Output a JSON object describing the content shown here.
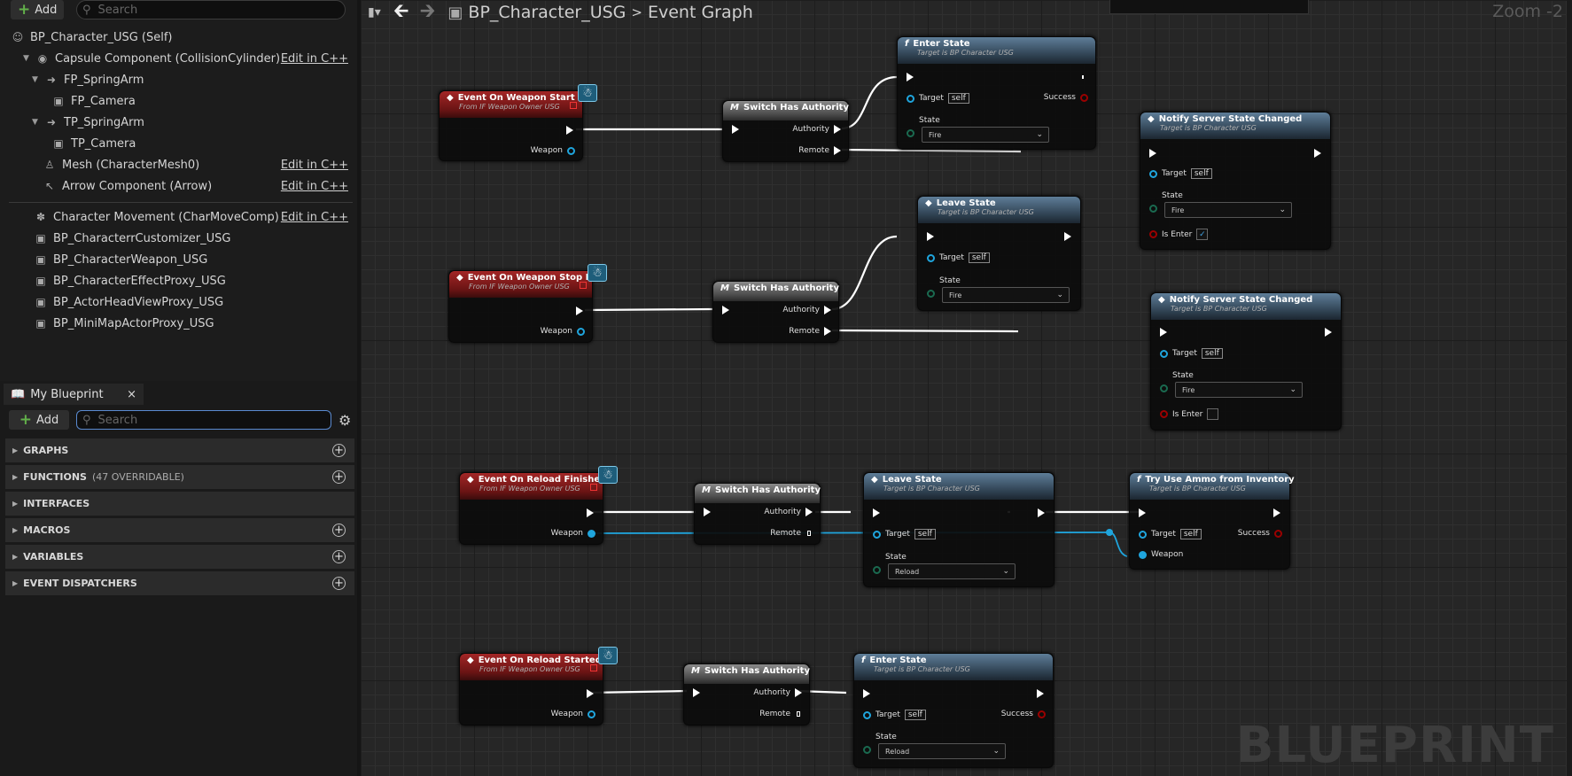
{
  "components": {
    "add_label": "Add",
    "search_placeholder": "Search",
    "items": [
      {
        "label": "BP_Character_USG (Self)"
      },
      {
        "label": "Capsule Component (CollisionCylinder)",
        "edit": "Edit in C++"
      },
      {
        "label": "FP_SpringArm"
      },
      {
        "label": "FP_Camera"
      },
      {
        "label": "TP_SpringArm"
      },
      {
        "label": "TP_Camera"
      },
      {
        "label": "Mesh (CharacterMesh0)",
        "edit": "Edit in C++"
      },
      {
        "label": "Arrow Component (Arrow)",
        "edit": "Edit in C++"
      },
      {
        "label": "Character Movement (CharMoveComp)",
        "edit": "Edit in C++"
      },
      {
        "label": "BP_CharacterrCustomizer_USG"
      },
      {
        "label": "BP_CharacterWeapon_USG"
      },
      {
        "label": "BP_CharacterEffectProxy_USG"
      },
      {
        "label": "BP_ActorHeadViewProxy_USG"
      },
      {
        "label": "BP_MiniMapActorProxy_USG"
      }
    ]
  },
  "my_blueprint": {
    "tab": "My Blueprint",
    "close": "×",
    "add_label": "Add",
    "search_placeholder": "Search",
    "sections": [
      {
        "label": "GRAPHS",
        "count": "",
        "add": true
      },
      {
        "label": "FUNCTIONS",
        "count": "(47 OVERRIDABLE)",
        "add": true
      },
      {
        "label": "INTERFACES",
        "count": "",
        "add": false
      },
      {
        "label": "MACROS",
        "count": "",
        "add": true
      },
      {
        "label": "VARIABLES",
        "count": "",
        "add": true
      },
      {
        "label": "EVENT DISPATCHERS",
        "count": "",
        "add": true
      }
    ]
  },
  "graph": {
    "breadcrumb_bp": "BP_Character_USG",
    "breadcrumb_sep": ">",
    "breadcrumb_graph": "Event Graph",
    "zoom": "Zoom -2",
    "watermark": "BLUEPRINT",
    "pins": {
      "weapon": "Weapon",
      "authority": "Authority",
      "remote": "Remote",
      "target": "Target",
      "self": "self",
      "state": "State",
      "success": "Success",
      "is_enter": "Is Enter"
    },
    "subtitles": {
      "event": "From IF Weapon Owner USG",
      "target": "Target is BP Character USG"
    },
    "events": [
      "Event On Weapon Start Fire",
      "Event On Weapon Stop Fire",
      "Event On Reload Finished",
      "Event On Reload Started"
    ],
    "switch_title": "Switch Has Authority",
    "enter_state": "Enter State",
    "leave_state": "Leave State",
    "notify": "Notify Server State Changed",
    "try_ammo": "Try Use Ammo from Inventory",
    "state_fire": "Fire",
    "state_reload": "Reload"
  }
}
